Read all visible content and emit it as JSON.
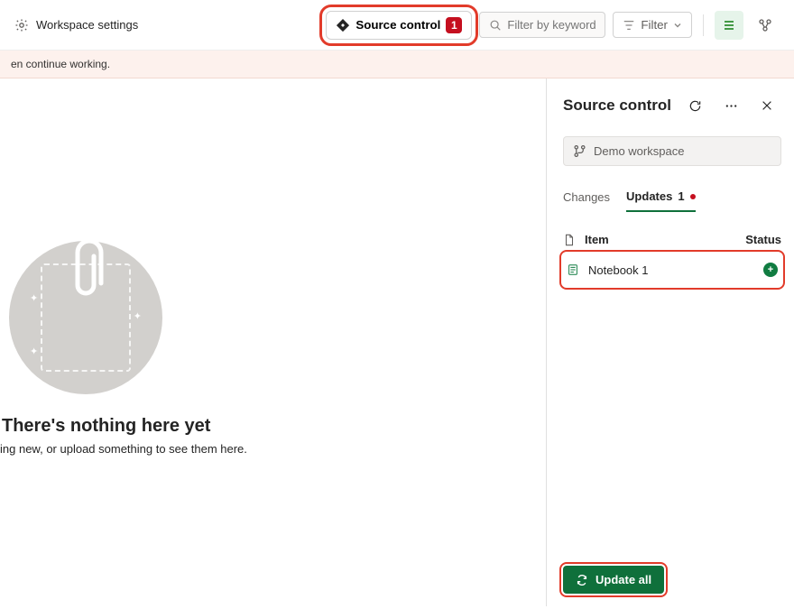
{
  "toolbar": {
    "workspace_settings_label": "Workspace settings",
    "source_control_label": "Source control",
    "source_control_badge": "1",
    "filter_input_placeholder": "Filter by keyword",
    "filter_button_label": "Filter"
  },
  "infobar": {
    "text": "en continue working."
  },
  "empty_state": {
    "title": "There's nothing here yet",
    "subtitle": "ing new, or upload something to see them here."
  },
  "panel": {
    "title": "Source control",
    "workspace_selector_label": "Demo workspace",
    "tabs": {
      "changes_label": "Changes",
      "updates_label": "Updates",
      "updates_count": "1"
    },
    "columns": {
      "item_label": "Item",
      "status_label": "Status"
    },
    "items": [
      {
        "name": "Notebook 1",
        "status": "added"
      }
    ],
    "update_all_label": "Update all"
  }
}
